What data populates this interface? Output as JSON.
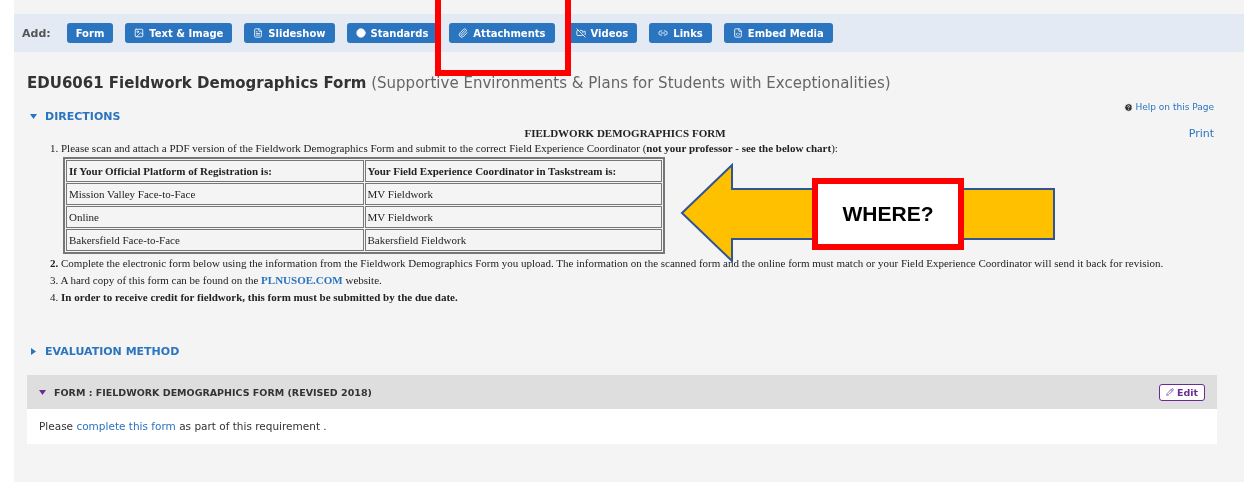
{
  "toolbar": {
    "label": "Add:",
    "buttons": [
      "Form",
      "Text & Image",
      "Slideshow",
      "Standards",
      "Attachments",
      "Videos",
      "Links",
      "Embed Media"
    ]
  },
  "title": {
    "main": "EDU6061 Fieldwork Demographics Form",
    "subtitle": "(Supportive Environments & Plans for Students with Exceptionalities)"
  },
  "help_link": "Help on this Page",
  "directions": {
    "label": "DIRECTIONS",
    "expanded": true,
    "print": "Print",
    "heading": "FIELDWORK DEMOGRAPHICS FORM",
    "intro": "1. Please scan and attach a PDF version of the Fieldwork Demographics Form and submit to the correct Field Experience Coordinator (**not your professor - see the below chart**):",
    "table": {
      "columns": [
        "If Your Official Platform of Registration is:",
        "Your Field Experience Coordinator in Taskstream is:"
      ],
      "rows": [
        [
          "Mission Valley Face-to-Face",
          "MV Fieldwork"
        ],
        [
          "Online",
          "MV Fieldwork"
        ],
        [
          "Bakersfield Face-to-Face",
          "Bakersfield Fieldwork"
        ]
      ]
    },
    "step_2": "**2.** Complete the electronic form below using the information from the Fieldwork Demographics Form you upload. The information on the scanned form and the online form must match or your Field Experience Coordinator will send it back for revision.",
    "step_3": {
      "before": "3. A hard copy of this form can be found on the ",
      "link": "PLNUSOE.COM",
      "after": " website."
    },
    "step_4": "4. **In order to receive credit for fieldwork, this form must be submitted by the due date.**"
  },
  "evaluation": {
    "label": "EVALUATION METHOD",
    "expanded": false
  },
  "form_panel": {
    "title": "FORM : FIELDWORK DEMOGRAPHICS FORM (REVISED 2018)",
    "expanded": true,
    "edit": "Edit",
    "before": "Please ",
    "link": "complete this form",
    "after": " as part of this requirement ."
  },
  "annotation": {
    "callout": "WHERE?"
  }
}
